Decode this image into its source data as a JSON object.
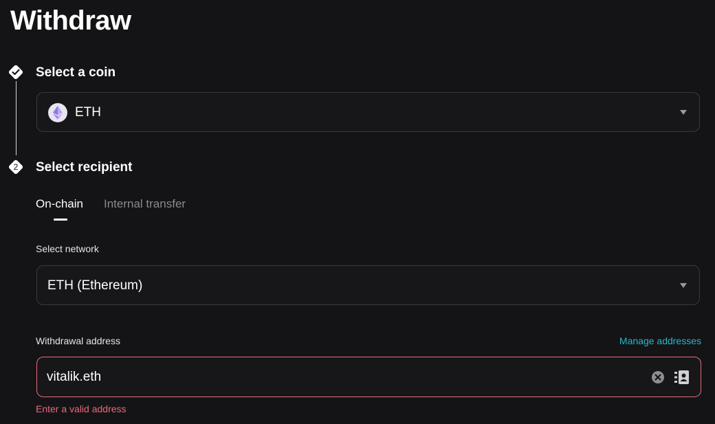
{
  "page": {
    "title": "Withdraw"
  },
  "steps": [
    {
      "label": "Select a coin",
      "status": "complete"
    },
    {
      "label": "Select recipient",
      "number": "2"
    }
  ],
  "coin": {
    "selected": "ETH",
    "icon": "ethereum-icon"
  },
  "recipient": {
    "tabs": [
      {
        "label": "On-chain",
        "active": true
      },
      {
        "label": "Internal transfer",
        "active": false
      }
    ],
    "network": {
      "label": "Select network",
      "selected": "ETH (Ethereum)"
    },
    "address": {
      "label": "Withdrawal address",
      "manage_link": "Manage addresses",
      "value": "vitalik.eth",
      "error": "Enter a valid address"
    }
  },
  "colors": {
    "background": "#141416",
    "error": "#e86a7c",
    "link": "#29b6c9"
  }
}
